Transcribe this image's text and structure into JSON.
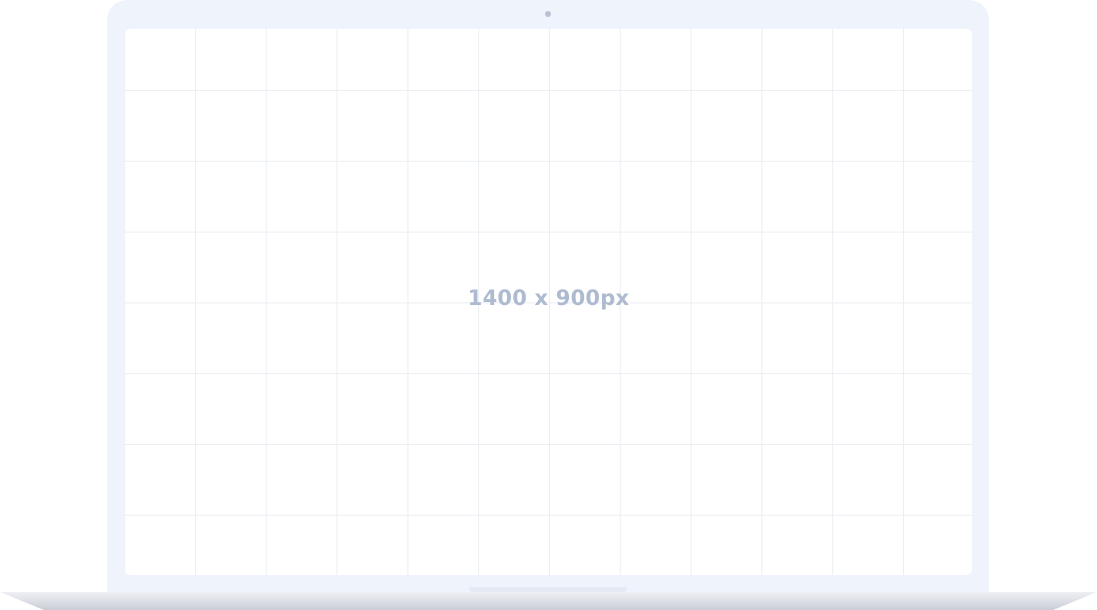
{
  "screen": {
    "resolution_label": "1400 x 900px"
  },
  "colors": {
    "lid": "#eef3fc",
    "screen_background": "#ffffff",
    "grid_line": "#ebeef3",
    "label_text": "#adbad0"
  },
  "icons": {
    "camera": "camera-icon"
  }
}
